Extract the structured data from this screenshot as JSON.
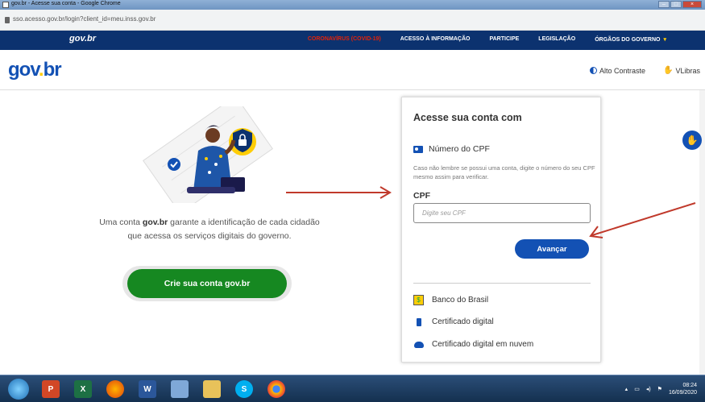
{
  "browser": {
    "window_title": "gov.br - Acesse sua conta - Google Chrome",
    "url": "sso.acesso.gov.br/login?client_id=meu.inss.gov.br"
  },
  "topnav": {
    "logo": "gov.br",
    "items": [
      "CORONAVÍRUS (COVID-19)",
      "ACESSO À INFORMAÇÃO",
      "PARTICIPE",
      "LEGISLAÇÃO",
      "ÓRGÃOS DO GOVERNO"
    ]
  },
  "header": {
    "brand_gov": "gov",
    "brand_dot": ".",
    "brand_br": "br",
    "high_contrast": "Alto Contraste",
    "vlibras": "VLibras"
  },
  "left": {
    "desc_prefix": "Uma conta ",
    "desc_bold": "gov.br",
    "desc_suffix": " garante a identificação de cada cidadão que acessa os serviços digitais do governo.",
    "create_button": "Crie sua conta gov.br"
  },
  "card": {
    "title": "Acesse sua conta com",
    "cpf_option": "Número do CPF",
    "hint": "Caso não lembre se possui uma conta, digite o número do seu CPF mesmo assim para verificar.",
    "cpf_label": "CPF",
    "cpf_placeholder": "Digite seu CPF",
    "next_button": "Avançar",
    "options": [
      "Banco do Brasil",
      "Certificado digital",
      "Certificado digital em nuvem"
    ]
  },
  "taskbar": {
    "time": "08:24",
    "date": "16/09/2020"
  },
  "colors": {
    "brand_blue": "#1351b4",
    "dark_nav": "#0c326f",
    "green": "#168821",
    "yellow": "#ffcd07",
    "annotation_red": "#c0392b"
  }
}
